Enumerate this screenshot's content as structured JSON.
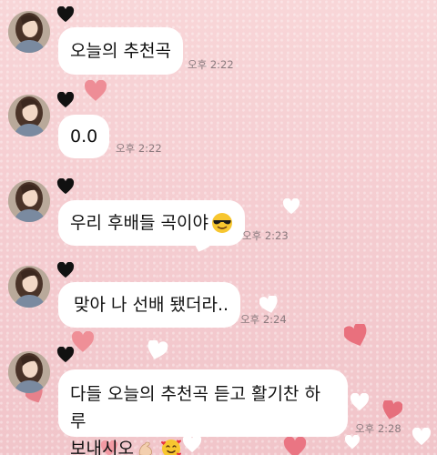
{
  "chat": {
    "messages": [
      {
        "text": "오늘의 추천곡",
        "time": "오후 2:22",
        "emoji": ""
      },
      {
        "text": "0.0",
        "time": "오후 2:22",
        "emoji": ""
      },
      {
        "text": "우리 후배들 곡이야",
        "time": "오후 2:23",
        "emoji": "sunglasses-emoji"
      },
      {
        "text": "맞아 나 선배 됐더라..",
        "time": "오후 2:24",
        "emoji": ""
      },
      {
        "line1": "다들 오늘의 추천곡 듣고 활기찬 하루",
        "line2": "보내시오",
        "time": "오후 2:28",
        "emoji": [
          "flexed-biceps-emoji",
          "smiling-face-with-hearts-emoji"
        ]
      }
    ]
  },
  "colors": {
    "background": "#f5cdd1",
    "bubble": "#ffffff",
    "timestamp": "#8a7a7e",
    "badge_heart": "#111111"
  }
}
